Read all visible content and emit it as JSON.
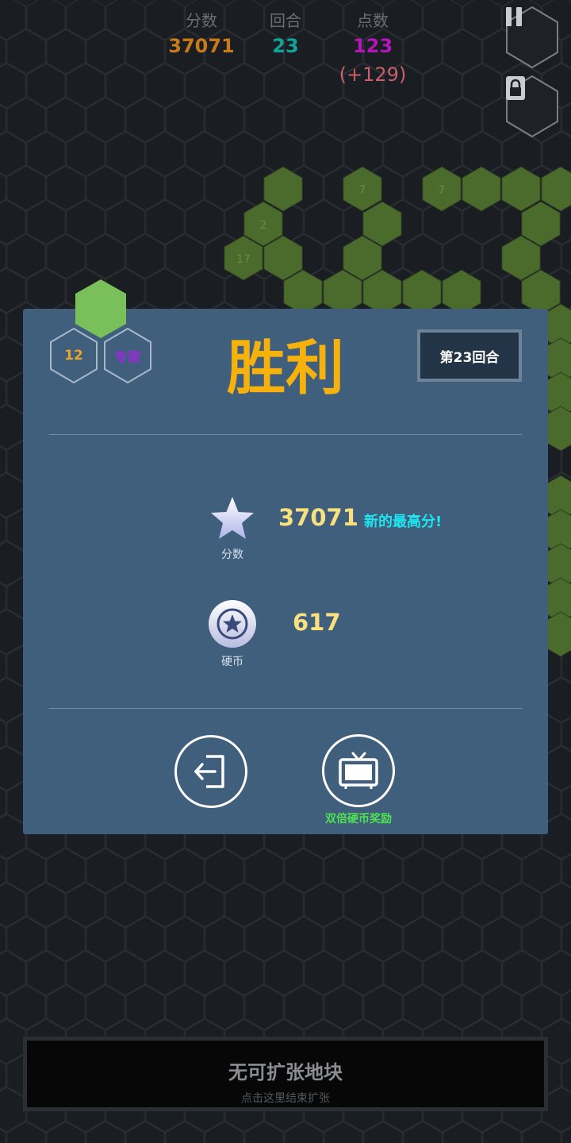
{
  "top_stats": {
    "score": {
      "label": "分数",
      "value": "37071"
    },
    "round": {
      "label": "回合",
      "value": "23"
    },
    "points": {
      "label": "点数",
      "value": "123",
      "delta": "(+129)"
    }
  },
  "colors": {
    "background": "#1a1d21",
    "hex_outline": "#2b2f35",
    "green_tile": "#4a6b2c",
    "green_tile_text": "#6a8a46",
    "modal_bg": "#3f5f7d",
    "score_orange": "#c77a1a",
    "round_teal": "#14a39a",
    "points_magenta": "#b317b8",
    "points_delta": "#c8606b",
    "victory_yellow": "#f6b10d",
    "value_yellow": "#f9e07e",
    "record_cyan": "#1fe5f0",
    "reward_green": "#4fe34f",
    "mode_purple": "#9b2bd9",
    "level_orange": "#e8a52a"
  },
  "board": {
    "tile_numbers": [
      "7",
      "7",
      "2",
      "17"
    ]
  },
  "controls": {
    "pause_icon": "pause-icon",
    "lock_icon": "lock-icon"
  },
  "modal": {
    "level": "12",
    "mode": "专家",
    "title": "胜利",
    "round_label": "第23回合",
    "score_caption": "分数",
    "score_value": "37071",
    "new_record": "新的最高分!",
    "coin_caption": "硬币",
    "coin_value": "617",
    "exit_icon": "exit-icon",
    "video_icon": "tv-icon",
    "double_reward_label": "双倍硬币奖励"
  },
  "bottom_bar": {
    "title": "无可扩张地块",
    "subtitle": "点击这里结束扩张"
  }
}
